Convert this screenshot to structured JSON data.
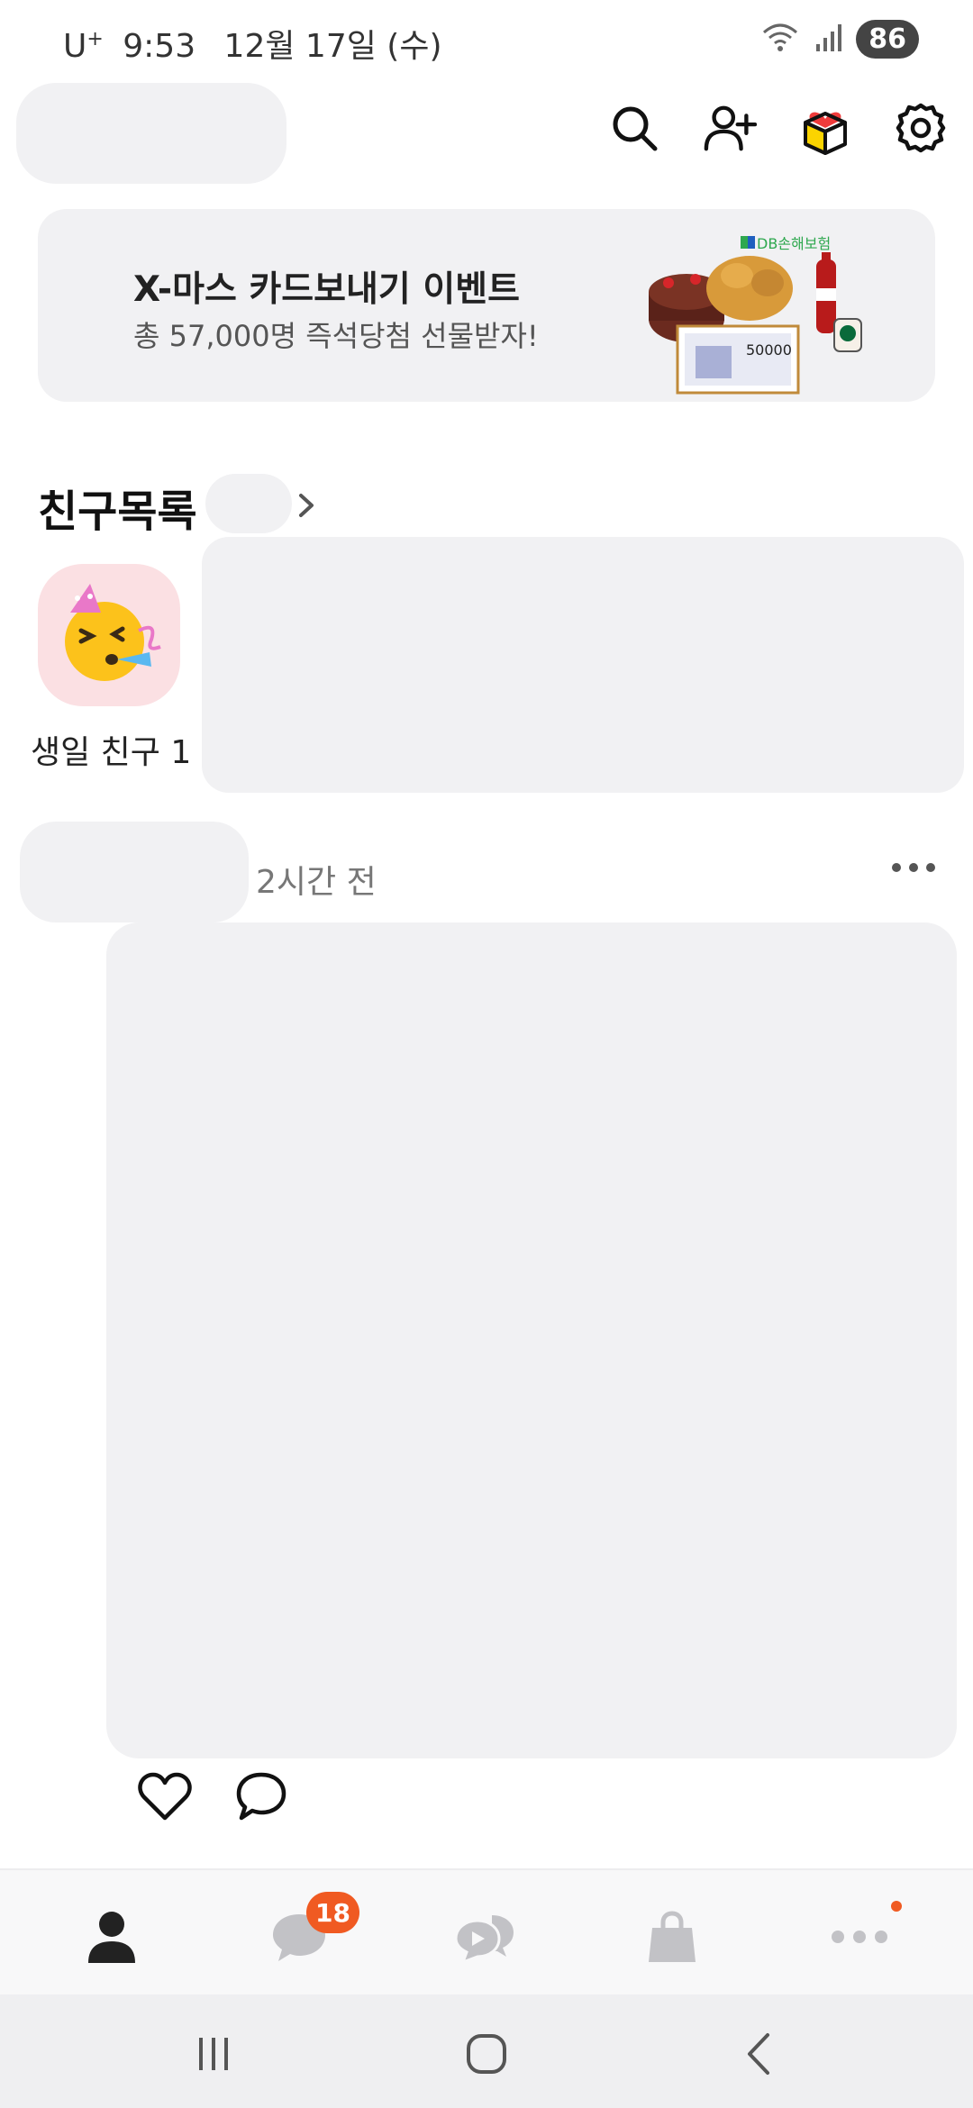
{
  "status_bar": {
    "carrier": "U",
    "carrier_sup": "+",
    "time": "9:53",
    "date": "12월 17일 (수)",
    "battery": "86"
  },
  "header": {
    "icons": [
      "search-icon",
      "add-friend-icon",
      "gift-icon",
      "settings-icon"
    ]
  },
  "banner": {
    "title": "X-마스 카드보내기 이벤트",
    "subtitle": "총 57,000명 즉석당첨 선물받자!",
    "sponsor": "DB손해보험",
    "voucher_amount": "50000"
  },
  "friends": {
    "title": "친구목록",
    "birthday_label": "생일 친구 1"
  },
  "post": {
    "time_ago": "2시간 전"
  },
  "bottom_nav": {
    "items": [
      "friends-tab",
      "chats-tab",
      "openchat-tab",
      "shopping-tab",
      "more-tab"
    ],
    "chat_badge": "18",
    "colors": {
      "accent": "#f05a22",
      "active": "#222222",
      "inactive": "#c2c2c6"
    }
  }
}
